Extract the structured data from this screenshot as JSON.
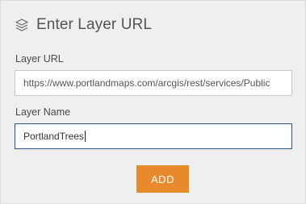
{
  "panel": {
    "title": "Enter Layer URL",
    "title_icon": "layers-icon"
  },
  "form": {
    "url_label": "Layer URL",
    "url_value": "https://www.portlandmaps.com/arcgis/rest/services/Public",
    "name_label": "Layer Name",
    "name_value": "PortlandTrees"
  },
  "actions": {
    "add_label": "ADD"
  },
  "colors": {
    "accent": "#e8892c",
    "focus_border": "#2a5590",
    "panel_bg": "#efefef"
  }
}
